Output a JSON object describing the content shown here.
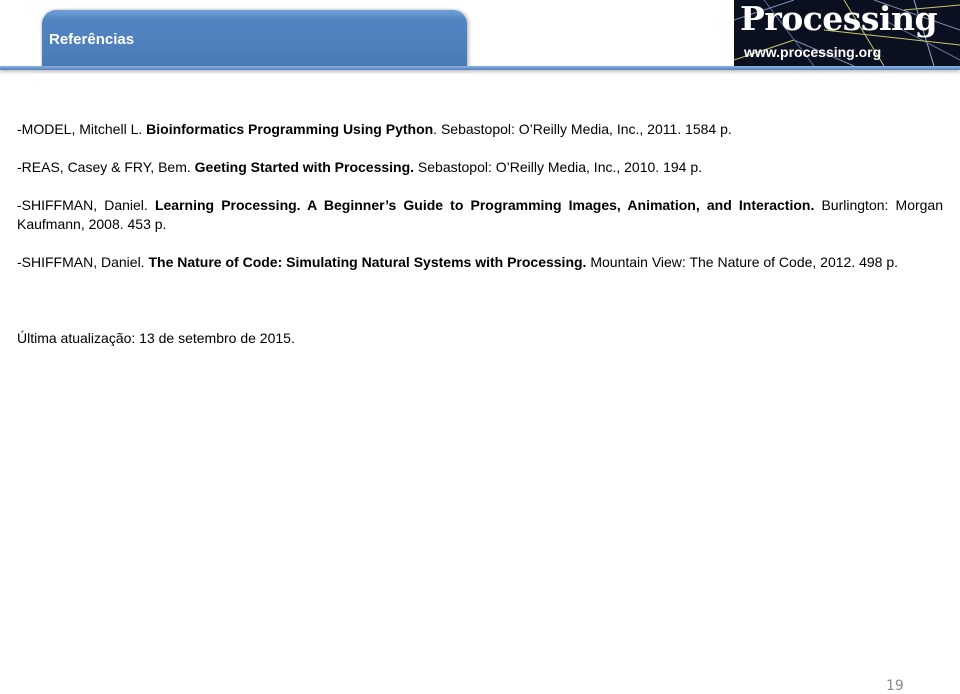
{
  "header": {
    "title": "Referências",
    "logo": {
      "name": "Processing",
      "url": "www.processing.org"
    },
    "accent_color": "#4f81bd"
  },
  "references": [
    {
      "author": "-MODEL, Mitchell L. ",
      "title": "Bioinformatics Programming Using Python",
      "rest": ". Sebastopol: O’Reilly Media, Inc., 2011. 1584 p."
    },
    {
      "author": "-REAS, Casey & FRY, Bem. ",
      "title": "Geeting Started with Processing.",
      "rest": " Sebastopol: O’Reilly Media, Inc., 2010. 194 p."
    },
    {
      "author": "-SHIFFMAN, Daniel. ",
      "title": "Learning Processing. A Beginner’s Guide to Programming Images, Animation, and Interaction.",
      "rest": " Burlington: Morgan Kaufmann, 2008. 453 p."
    },
    {
      "author": "-SHIFFMAN, Daniel. ",
      "title": "The Nature of Code: Simulating Natural Systems with Processing.",
      "rest": " Mountain View: The Nature of Code, 2012. 498 p."
    }
  ],
  "last_updated": "Última atualização: 13 de setembro de 2015.",
  "page_number": "19"
}
